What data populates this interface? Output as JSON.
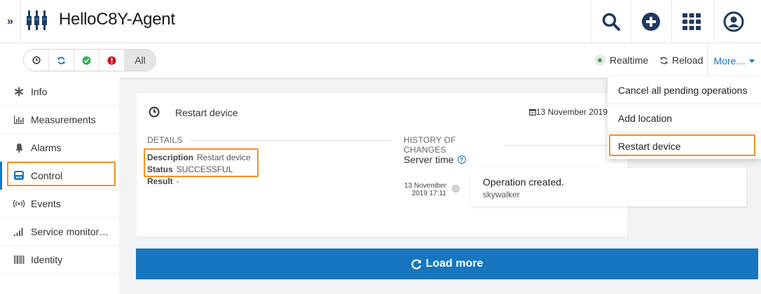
{
  "header": {
    "expand_glyph": "»",
    "app_title": "HelloC8Y-Agent",
    "right_icons": [
      "search-icon",
      "add-icon",
      "app-grid-icon",
      "user-icon"
    ]
  },
  "filters": {
    "icons": [
      "clock-icon",
      "refresh-icon",
      "check-icon",
      "error-icon"
    ],
    "all_label": "All"
  },
  "toolbar": {
    "realtime_label": "Realtime",
    "reload_label": "Reload",
    "more_label": "More…"
  },
  "sidebar": {
    "items": [
      {
        "label": "Info",
        "icon": "asterisk-icon"
      },
      {
        "label": "Measurements",
        "icon": "bar-chart-icon"
      },
      {
        "label": "Alarms",
        "icon": "bell-icon"
      },
      {
        "label": "Control",
        "icon": "control-icon",
        "active": true
      },
      {
        "label": "Events",
        "icon": "broadcast-icon"
      },
      {
        "label": "Service monitor…",
        "icon": "signal-icon"
      },
      {
        "label": "Identity",
        "icon": "barcode-icon"
      }
    ]
  },
  "operation": {
    "title": "Restart device",
    "date": "13 November 2019",
    "details_header": "DETAILS",
    "history_header": "HISTORY OF CHANGES",
    "description_label": "Description",
    "description_value": "Restart device",
    "status_label": "Status",
    "status_value": "SUCCESSFUL",
    "result_label": "Result",
    "result_value": "-",
    "server_time_label": "Server time",
    "history": [
      {
        "time_line1": "13 November",
        "time_line2": "2019 17:11",
        "message": "Operation created.",
        "user": "skywalker"
      }
    ]
  },
  "load_more_label": "Load more",
  "more_menu": {
    "items": [
      "Cancel all pending operations",
      "Add location",
      "Restart device"
    ]
  },
  "colors": {
    "accent": "#1776bf",
    "highlight": "#f29021",
    "success": "#2bb24c",
    "danger": "#d9091a",
    "icon_dark": "#1f3a5f"
  }
}
